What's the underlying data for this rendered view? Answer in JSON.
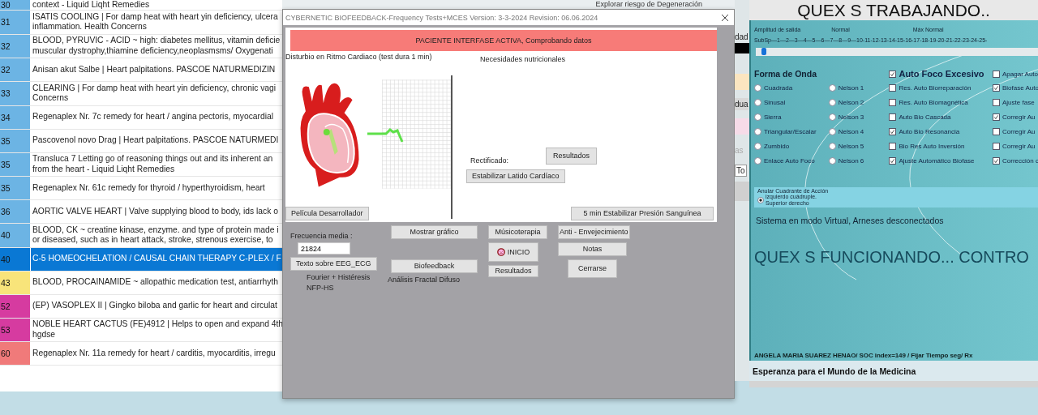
{
  "list": {
    "rows": [
      {
        "number": "30",
        "color": "#6cb4e4",
        "selected": false,
        "lines": [
          "context - Liquid Liqht Remedies"
        ]
      },
      {
        "number": "31",
        "color": "#6cb4e4",
        "selected": false,
        "lines": [
          "ISATIS COOLING | For damp heat with heart yin deficiency, ulcera",
          "inflammation. Health Concerns"
        ]
      },
      {
        "number": "32",
        "color": "#6cb4e4",
        "selected": false,
        "lines": [
          "BLOOD, PYRUVIC - ACID ~ high: diabetes mellitus, vitamin deficie",
          "muscular dystrophy,thiamine deficiency,neoplasmsms/ Oxygenati"
        ]
      },
      {
        "number": "32",
        "color": "#6cb4e4",
        "selected": false,
        "lines": [
          "Anisan akut Salbe | Heart palpitations. PASCOE NATURMEDIZIN"
        ]
      },
      {
        "number": "33",
        "color": "#6cb4e4",
        "selected": false,
        "lines": [
          "CLEARING | For damp heat with heart yin deficiency, chronic vagi",
          "Concerns"
        ]
      },
      {
        "number": "34",
        "color": "#6cb4e4",
        "selected": false,
        "lines": [
          "Regenaplex Nr. 7c remedy for heart / angina pectoris, myocardial"
        ]
      },
      {
        "number": "35",
        "color": "#6cb4e4",
        "selected": false,
        "lines": [
          "Pascovenol novo Drag | Heart palpitations. PASCOE NATURMEDI"
        ]
      },
      {
        "number": "35",
        "color": "#6cb4e4",
        "selected": false,
        "lines": [
          "Transluca 7 Letting go of reasoning things out and its inherent an",
          "from the heart - Liquid Liqht Remedies"
        ]
      },
      {
        "number": "35",
        "color": "#6cb4e4",
        "selected": false,
        "lines": [
          "Regenaplex Nr. 61c remedy  for  thyroid  / hyperthyroidism, heart"
        ]
      },
      {
        "number": "36",
        "color": "#6cb4e4",
        "selected": false,
        "lines": [
          "AORTIC VALVE HEART | Valve supplying blood to body, ids lack o"
        ]
      },
      {
        "number": "40",
        "color": "#6cb4e4",
        "selected": false,
        "lines": [
          "BLOOD, CK ~ creatine kinase, enzyme. and type of protein made i",
          "or diseased, such as in heart attack, stroke, strenous exercise, to"
        ]
      },
      {
        "number": "40",
        "color": "#0a78d4",
        "selected": true,
        "lines": [
          "C-5 HOMEOCHELATION / CAUSAL CHAIN THERAPY C-PLEX / F"
        ]
      },
      {
        "number": "43",
        "color": "#f8e47a",
        "selected": false,
        "lines": [
          "BLOOD, PROCAINAMIDE ~ allopathic medication test, antiarrhyth"
        ]
      },
      {
        "number": "52",
        "color": "#d63ba0",
        "selected": false,
        "lines": [
          "(EP) VASOPLEX II | Gingko biloba and garlic for heart and circulat"
        ]
      },
      {
        "number": "53",
        "color": "#d63ba0",
        "selected": false,
        "lines": [
          "NOBLE HEART CACTUS (FE)4912 | Helps to open and expand 4th",
          "hgdse"
        ]
      },
      {
        "number": "60",
        "color": "#f07a7a",
        "selected": false,
        "lines": [
          "Regenaplex Nr. 11a remedy for heart / carditis, myocarditis, irregu"
        ]
      }
    ]
  },
  "background": {
    "top_text": "Explorar riesgo de Degeneración",
    "side_texts": [
      "dad",
      "dua",
      "as",
      "To"
    ]
  },
  "dialog": {
    "title": "CYBERNETIC BIOFEEDBACK-Frequency Tests+MCES Version: 3-3-2024 Revision: 06.06.2024",
    "banner": "PACIENTE INTERFASE ACTIVA, Comprobando datos",
    "left_label": "Disturbio en Ritmo Cardiaco (test dura 1 min)",
    "right_label": "Necesidades nutricionales",
    "rectified_label": "Rectificado:",
    "results_button": "Resultados",
    "stabilize_button": "Estabilizar Latido Cardíaco",
    "film_button": "Película Desarrollador",
    "pressure_button": "5 min Estabilizar Presión Sanguínea",
    "frequency_label": "Frecuencia media :",
    "frequency_value": "21824",
    "eeg_button": "Texto sobre EEG_ECG",
    "fourier_text": "Fourier + Histéresis",
    "nfp_text": "NFP-HS",
    "graph_button": "Mostrar gráfico",
    "biofeedback_button": "Biofeedback",
    "fractal_text": "Análisis Fractal Difuso",
    "music_button": "Músicoterapia",
    "start_button": "INICIO",
    "results_button_2": "Resultados",
    "aging_button": "Anti - Envejecimiento",
    "notes_button": "Notas",
    "close_button": "Cerrarse"
  },
  "panel": {
    "status_title": "QUEX S TRABAJANDO..",
    "amplitude_labels": [
      "Amplitud de salida",
      "Normal",
      "Máx Normal"
    ],
    "scale": "SubSp—1—2—3—4—5—6—7—8—9—10-11-12-13-14-15-16-17-18-19-20-21-22-23-24-25-",
    "amplitude_slider": {
      "level": 0.02
    },
    "waveform": {
      "title": "Forma de Onda",
      "options": [
        {
          "label": "Cuadrada",
          "selected": false
        },
        {
          "label": "Sinusal",
          "selected": false
        },
        {
          "label": "Sierra",
          "selected": false
        },
        {
          "label": "Triangular/Escalar",
          "selected": false
        },
        {
          "label": "Zumbido",
          "selected": false
        },
        {
          "label": "Enlace Auto Foco",
          "selected": false
        }
      ]
    },
    "nelson": {
      "options": [
        {
          "label": "Nelson 1",
          "selected": false
        },
        {
          "label": "Nelson 2",
          "selected": false
        },
        {
          "label": "Nelson 3",
          "selected": false
        },
        {
          "label": "Nelson 4",
          "selected": false
        },
        {
          "label": "Nelson 5",
          "selected": false
        },
        {
          "label": "Nelson 6",
          "selected": false
        }
      ]
    },
    "auto_focus": {
      "label": "Auto Foco Excesivo",
      "checked": true,
      "options": [
        {
          "label": "Res. Auto Biorreparación",
          "checked": false
        },
        {
          "label": "Res. Auto Biomagnética",
          "checked": false
        },
        {
          "label": "Auto Bio Cascada",
          "checked": false
        },
        {
          "label": "Auto Bio Resonancia",
          "checked": true
        },
        {
          "label": "Bio Res Auto Inversión",
          "checked": false
        },
        {
          "label": "Ajuste Automático Biofase",
          "checked": true
        }
      ]
    },
    "extra_options": [
      {
        "label": "Apagar Auto",
        "checked": false
      },
      {
        "label": "Biofase Auto",
        "checked": true
      },
      {
        "label": "Ajuste fase",
        "checked": false
      },
      {
        "label": "Corregir Au",
        "checked": true
      },
      {
        "label": "Corregir Au",
        "checked": false
      },
      {
        "label": "Corregir Au",
        "checked": false
      },
      {
        "label": "Corrección c",
        "checked": true
      }
    ],
    "quadrant": {
      "title": "Anular Cuadrante de Acción",
      "option_lines": [
        "izquierdo cuádruple.",
        "Superior derecho"
      ],
      "selected": true
    },
    "system_message": "Sistema en modo Virtual, Arneses desconectados",
    "running_banner": "QUEX S FUNCIONANDO... CONTRO",
    "patient_line": "ANGELA  MARIA  SUAREZ  HENAO/ SOC index=149 / Fijar Tiempo seg/ Rx",
    "footer": "Esperanza para el Mundo de la Medicina"
  }
}
